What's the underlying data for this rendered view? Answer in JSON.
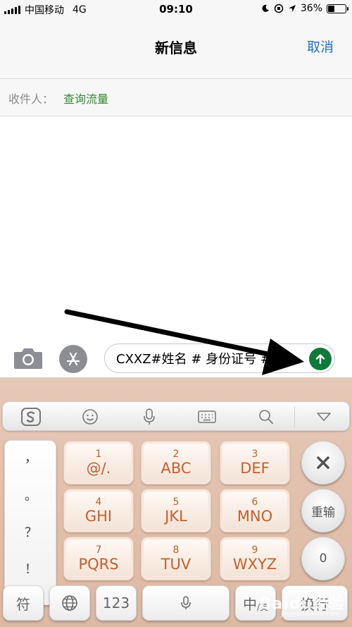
{
  "status_bar": {
    "carrier": "中国移动",
    "network": "4G",
    "time": "09:10",
    "battery": "36%",
    "battery_level": 0.36
  },
  "nav": {
    "title": "新信息",
    "cancel": "取消"
  },
  "recipient": {
    "label": "收件人：",
    "value": "查询流量"
  },
  "compose": {
    "text": "CXXZ#姓名 # 身份证号 #"
  },
  "keyboard": {
    "keys": [
      {
        "num": "1",
        "letters": "@/."
      },
      {
        "num": "2",
        "letters": "ABC"
      },
      {
        "num": "3",
        "letters": "DEF"
      },
      {
        "num": "4",
        "letters": "GHI"
      },
      {
        "num": "5",
        "letters": "JKL"
      },
      {
        "num": "6",
        "letters": "MNO"
      },
      {
        "num": "7",
        "letters": "PQRS"
      },
      {
        "num": "8",
        "letters": "TUV"
      },
      {
        "num": "9",
        "letters": "WXYZ"
      }
    ],
    "punctuation": [
      "，",
      "。",
      "？",
      "！"
    ],
    "retype": "重输",
    "zero": "0",
    "symbol": "符",
    "num_mode": "123",
    "lang_main": "中",
    "lang_sub": "/英",
    "enter": "换行"
  },
  "watermark": {
    "text": "Baidu经验",
    "sub": "jingyan.baidu.com"
  },
  "colors": {
    "accent_blue": "#1f6fd6",
    "recipient_green": "#2e8b2e",
    "send_green": "#0d7a3a",
    "key_text": "#c2612e"
  }
}
